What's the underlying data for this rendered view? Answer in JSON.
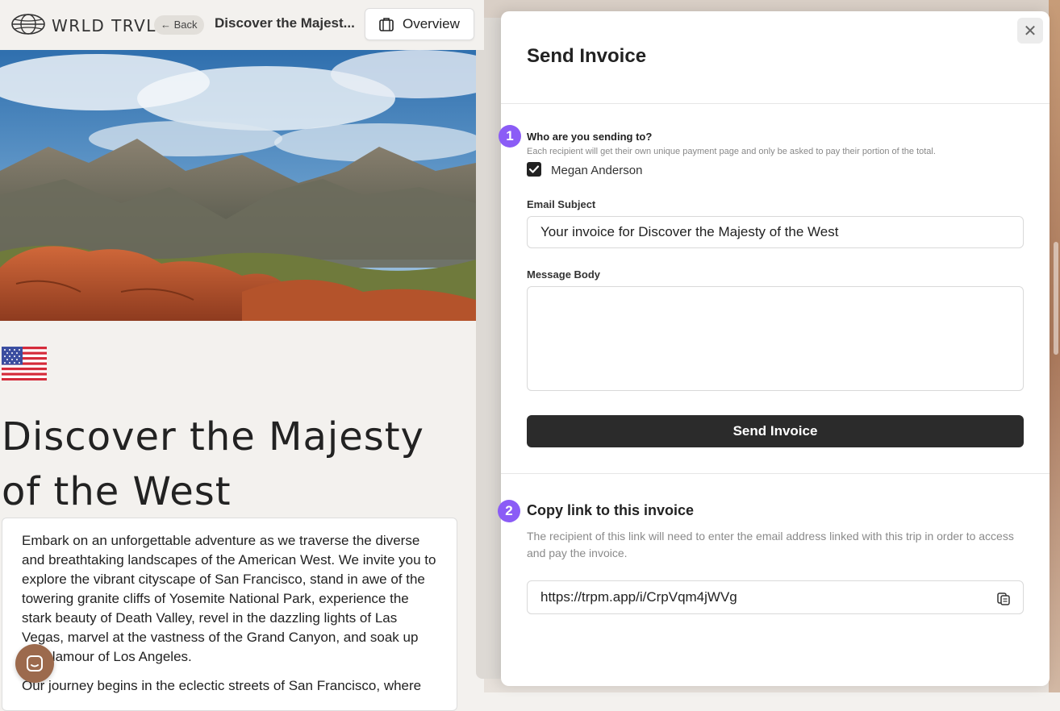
{
  "app": {
    "logo_text": "WRLD TRVL"
  },
  "header": {
    "back_label": "← Back",
    "trip_title": "Discover the Majest...",
    "overview_label": "Overview"
  },
  "page": {
    "title": "Discover the Majesty of the West",
    "paragraphs": [
      "Embark on an unforgettable adventure as we traverse the diverse and breathtaking landscapes of the American West. We invite you to explore the vibrant cityscape of San Francisco, stand in awe of the towering granite cliffs of Yosemite National Park, experience the stark beauty of Death Valley, revel in the dazzling lights of Las Vegas, marvel at the vastness of the Grand Canyon, and soak up the glamour of Los Angeles.",
      "Our journey begins in the eclectic streets of San Francisco, where"
    ]
  },
  "modal": {
    "title": "Send Invoice",
    "close_symbol": "✕",
    "step1": {
      "number": "1",
      "question": "Who are you sending to?",
      "help": "Each recipient will get their own unique payment page and only be asked to pay their portion of the total.",
      "recipients": [
        {
          "name": "Megan Anderson",
          "checked": true
        }
      ]
    },
    "email_subject_label": "Email Subject",
    "email_subject_value": "Your invoice for Discover the Majesty of the West",
    "message_body_label": "Message Body",
    "message_body_value": "",
    "send_button_label": "Send Invoice",
    "step2": {
      "number": "2",
      "title": "Copy link to this invoice",
      "help": "The recipient of this link will need to enter the email address linked with this trip in order to access and pay the invoice.",
      "link": "https://trpm.app/i/CrpVqm4jWVg"
    }
  },
  "colors": {
    "accent_purple": "#8b5cf6",
    "button_dark": "#2b2b2b",
    "page_background": "#f3f1ee",
    "chat_button": "#9c6a4d"
  },
  "icons": {
    "logo": "globe-icon",
    "overview": "suitcase-icon",
    "close": "close-icon",
    "checkbox": "check-icon",
    "copy": "copy-icon",
    "chat": "chat-icon",
    "flag": "us-flag-icon"
  }
}
